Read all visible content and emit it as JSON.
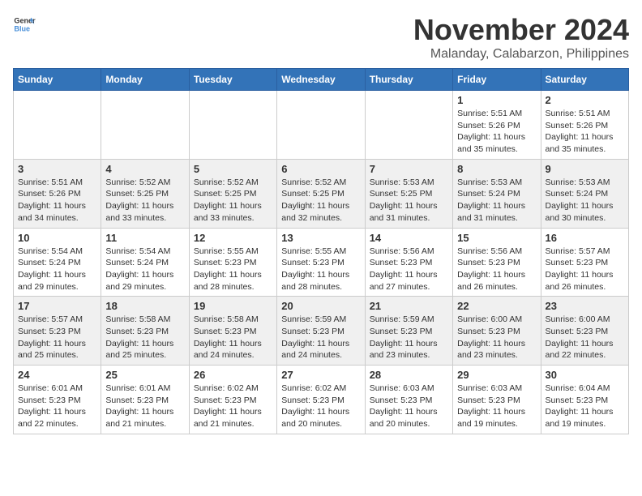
{
  "header": {
    "logo_general": "General",
    "logo_blue": "Blue",
    "month_title": "November 2024",
    "location": "Malanday, Calabarzon, Philippines"
  },
  "columns": [
    "Sunday",
    "Monday",
    "Tuesday",
    "Wednesday",
    "Thursday",
    "Friday",
    "Saturday"
  ],
  "weeks": [
    [
      {
        "day": "",
        "sunrise": "",
        "sunset": "",
        "daylight": ""
      },
      {
        "day": "",
        "sunrise": "",
        "sunset": "",
        "daylight": ""
      },
      {
        "day": "",
        "sunrise": "",
        "sunset": "",
        "daylight": ""
      },
      {
        "day": "",
        "sunrise": "",
        "sunset": "",
        "daylight": ""
      },
      {
        "day": "",
        "sunrise": "",
        "sunset": "",
        "daylight": ""
      },
      {
        "day": "1",
        "sunrise": "Sunrise: 5:51 AM",
        "sunset": "Sunset: 5:26 PM",
        "daylight": "Daylight: 11 hours and 35 minutes."
      },
      {
        "day": "2",
        "sunrise": "Sunrise: 5:51 AM",
        "sunset": "Sunset: 5:26 PM",
        "daylight": "Daylight: 11 hours and 35 minutes."
      }
    ],
    [
      {
        "day": "3",
        "sunrise": "Sunrise: 5:51 AM",
        "sunset": "Sunset: 5:26 PM",
        "daylight": "Daylight: 11 hours and 34 minutes."
      },
      {
        "day": "4",
        "sunrise": "Sunrise: 5:52 AM",
        "sunset": "Sunset: 5:25 PM",
        "daylight": "Daylight: 11 hours and 33 minutes."
      },
      {
        "day": "5",
        "sunrise": "Sunrise: 5:52 AM",
        "sunset": "Sunset: 5:25 PM",
        "daylight": "Daylight: 11 hours and 33 minutes."
      },
      {
        "day": "6",
        "sunrise": "Sunrise: 5:52 AM",
        "sunset": "Sunset: 5:25 PM",
        "daylight": "Daylight: 11 hours and 32 minutes."
      },
      {
        "day": "7",
        "sunrise": "Sunrise: 5:53 AM",
        "sunset": "Sunset: 5:25 PM",
        "daylight": "Daylight: 11 hours and 31 minutes."
      },
      {
        "day": "8",
        "sunrise": "Sunrise: 5:53 AM",
        "sunset": "Sunset: 5:24 PM",
        "daylight": "Daylight: 11 hours and 31 minutes."
      },
      {
        "day": "9",
        "sunrise": "Sunrise: 5:53 AM",
        "sunset": "Sunset: 5:24 PM",
        "daylight": "Daylight: 11 hours and 30 minutes."
      }
    ],
    [
      {
        "day": "10",
        "sunrise": "Sunrise: 5:54 AM",
        "sunset": "Sunset: 5:24 PM",
        "daylight": "Daylight: 11 hours and 29 minutes."
      },
      {
        "day": "11",
        "sunrise": "Sunrise: 5:54 AM",
        "sunset": "Sunset: 5:24 PM",
        "daylight": "Daylight: 11 hours and 29 minutes."
      },
      {
        "day": "12",
        "sunrise": "Sunrise: 5:55 AM",
        "sunset": "Sunset: 5:23 PM",
        "daylight": "Daylight: 11 hours and 28 minutes."
      },
      {
        "day": "13",
        "sunrise": "Sunrise: 5:55 AM",
        "sunset": "Sunset: 5:23 PM",
        "daylight": "Daylight: 11 hours and 28 minutes."
      },
      {
        "day": "14",
        "sunrise": "Sunrise: 5:56 AM",
        "sunset": "Sunset: 5:23 PM",
        "daylight": "Daylight: 11 hours and 27 minutes."
      },
      {
        "day": "15",
        "sunrise": "Sunrise: 5:56 AM",
        "sunset": "Sunset: 5:23 PM",
        "daylight": "Daylight: 11 hours and 26 minutes."
      },
      {
        "day": "16",
        "sunrise": "Sunrise: 5:57 AM",
        "sunset": "Sunset: 5:23 PM",
        "daylight": "Daylight: 11 hours and 26 minutes."
      }
    ],
    [
      {
        "day": "17",
        "sunrise": "Sunrise: 5:57 AM",
        "sunset": "Sunset: 5:23 PM",
        "daylight": "Daylight: 11 hours and 25 minutes."
      },
      {
        "day": "18",
        "sunrise": "Sunrise: 5:58 AM",
        "sunset": "Sunset: 5:23 PM",
        "daylight": "Daylight: 11 hours and 25 minutes."
      },
      {
        "day": "19",
        "sunrise": "Sunrise: 5:58 AM",
        "sunset": "Sunset: 5:23 PM",
        "daylight": "Daylight: 11 hours and 24 minutes."
      },
      {
        "day": "20",
        "sunrise": "Sunrise: 5:59 AM",
        "sunset": "Sunset: 5:23 PM",
        "daylight": "Daylight: 11 hours and 24 minutes."
      },
      {
        "day": "21",
        "sunrise": "Sunrise: 5:59 AM",
        "sunset": "Sunset: 5:23 PM",
        "daylight": "Daylight: 11 hours and 23 minutes."
      },
      {
        "day": "22",
        "sunrise": "Sunrise: 6:00 AM",
        "sunset": "Sunset: 5:23 PM",
        "daylight": "Daylight: 11 hours and 23 minutes."
      },
      {
        "day": "23",
        "sunrise": "Sunrise: 6:00 AM",
        "sunset": "Sunset: 5:23 PM",
        "daylight": "Daylight: 11 hours and 22 minutes."
      }
    ],
    [
      {
        "day": "24",
        "sunrise": "Sunrise: 6:01 AM",
        "sunset": "Sunset: 5:23 PM",
        "daylight": "Daylight: 11 hours and 22 minutes."
      },
      {
        "day": "25",
        "sunrise": "Sunrise: 6:01 AM",
        "sunset": "Sunset: 5:23 PM",
        "daylight": "Daylight: 11 hours and 21 minutes."
      },
      {
        "day": "26",
        "sunrise": "Sunrise: 6:02 AM",
        "sunset": "Sunset: 5:23 PM",
        "daylight": "Daylight: 11 hours and 21 minutes."
      },
      {
        "day": "27",
        "sunrise": "Sunrise: 6:02 AM",
        "sunset": "Sunset: 5:23 PM",
        "daylight": "Daylight: 11 hours and 20 minutes."
      },
      {
        "day": "28",
        "sunrise": "Sunrise: 6:03 AM",
        "sunset": "Sunset: 5:23 PM",
        "daylight": "Daylight: 11 hours and 20 minutes."
      },
      {
        "day": "29",
        "sunrise": "Sunrise: 6:03 AM",
        "sunset": "Sunset: 5:23 PM",
        "daylight": "Daylight: 11 hours and 19 minutes."
      },
      {
        "day": "30",
        "sunrise": "Sunrise: 6:04 AM",
        "sunset": "Sunset: 5:23 PM",
        "daylight": "Daylight: 11 hours and 19 minutes."
      }
    ]
  ]
}
